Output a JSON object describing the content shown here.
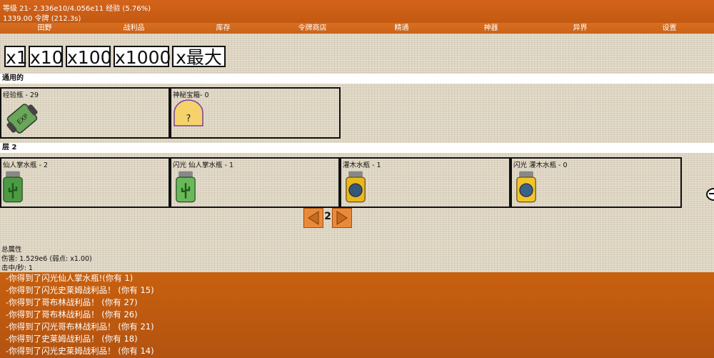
{
  "header": {
    "line1": "等级 21- 2.336e10/4.056e11 经验 (5.76%)",
    "line2": "1339.00 令牌 (212.3s)"
  },
  "nav": [
    "田野",
    "战利品",
    "库存",
    "令牌商店",
    "精通",
    "神器",
    "异界",
    "设置"
  ],
  "multipliers": [
    "x1",
    "x10",
    "x100",
    "x1000",
    "x最大"
  ],
  "sections": {
    "general": "通用的",
    "layer": "层 2"
  },
  "general_items": [
    {
      "label": "经验瓶 - 29",
      "icon": "exp-bottle-icon",
      "icon_text": "EXP"
    },
    {
      "label": "神秘宝箱- 0",
      "icon": "mystery-box-icon",
      "icon_text": "?"
    }
  ],
  "layer_items": [
    {
      "label": "仙人掌水瓶 - 2",
      "icon": "cactus-jar-icon"
    },
    {
      "label": "闪光 仙人掌水瓶 - 1",
      "icon": "shiny-cactus-jar-icon"
    },
    {
      "label": "灌木水瓶 - 1",
      "icon": "bush-jar-icon"
    },
    {
      "label": "闪光 灌木水瓶 - 0",
      "icon": "shiny-bush-jar-icon"
    }
  ],
  "pager": {
    "page": "2"
  },
  "stats": {
    "title": "总属性",
    "damage": "伤害: 1.529e6 (弱点: x1.00)",
    "hits": "击中/秒: 1"
  },
  "log": [
    "-你得到了闪光仙人掌水瓶!(你有 1)",
    "-你得到了闪光史莱姆战利品！ (你有 15)",
    "-你得到了哥布林战利品！ (你有 27)",
    "-你得到了哥布林战利品！ (你有 26)",
    "-你得到了闪光哥布林战利品！ (你有 21)",
    "-你得到了史莱姆战利品！ (你有 18)",
    "-你得到了闪光史莱姆战利品！ (你有 14)"
  ]
}
